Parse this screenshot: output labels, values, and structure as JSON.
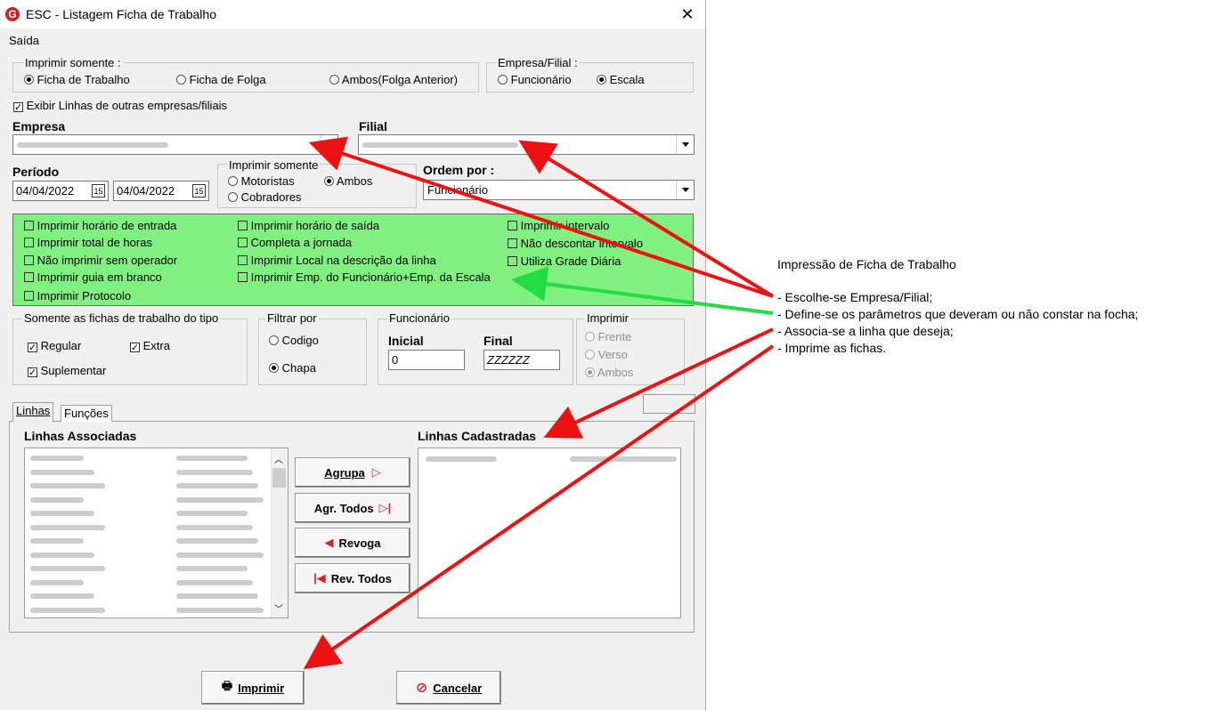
{
  "window": {
    "title": "ESC - Listagem Ficha de Trabalho",
    "menu": "Saída"
  },
  "imprimir_somente": {
    "legend": "Imprimir somente :",
    "options": [
      "Ficha de Trabalho",
      "Ficha de Folga",
      "Ambos(Folga Anterior)"
    ],
    "selected": "Ficha de Trabalho"
  },
  "empresa_filial": {
    "legend": "Empresa/Filial :",
    "options": [
      "Funcionário",
      "Escala"
    ],
    "selected": "Escala"
  },
  "exibir_linhas": {
    "label": "Exibir Linhas de outras empresas/filiais",
    "checked": true
  },
  "empresa": {
    "label": "Empresa"
  },
  "filial": {
    "label": "Filial"
  },
  "periodo": {
    "label": "Período",
    "start": "04/04/2022",
    "end": "04/04/2022",
    "cal_icon_text": "15"
  },
  "imprimir_somente2": {
    "legend": "Imprimir somente",
    "options": [
      "Motoristas",
      "Ambos",
      "Cobradores"
    ],
    "selected": "Ambos"
  },
  "ordem": {
    "label": "Ordem por :",
    "value": "Funcionário"
  },
  "options_panel": {
    "col1": [
      "Imprimir horário de entrada",
      "Imprimir total de horas",
      "Não imprimir sem operador",
      "Imprimir guia em branco",
      "Imprimir Protocolo"
    ],
    "col2": [
      "Imprimir horário de saída",
      "Completa a jornada",
      "Imprimir Local na descrição da linha",
      "Imprimir Emp. do Funcionário+Emp. da Escala"
    ],
    "col3": [
      "Imprimir intervalo",
      "Não descontar intervalo",
      "Utiliza Grade Diária"
    ]
  },
  "somente_fichas": {
    "legend": "Somente as fichas de trabalho do tipo",
    "regular": "Regular",
    "extra": "Extra",
    "suplementar": "Suplementar"
  },
  "filtrar": {
    "legend": "Filtrar por",
    "options": [
      "Codigo",
      "Chapa"
    ],
    "selected": "Chapa"
  },
  "funcionario": {
    "legend": "Funcionário",
    "inicial_label": "Inicial",
    "final_label": "Final",
    "inicial": "0",
    "final": "ZZZZZZ"
  },
  "imprimir": {
    "legend": "Imprimir",
    "options": [
      "Frente",
      "Verso",
      "Ambos"
    ],
    "selected": "Ambos"
  },
  "tabs": [
    "Linhas",
    "Funções"
  ],
  "linhas_associadas": {
    "label": "Linhas Associadas"
  },
  "linhas_cadastradas": {
    "label": "Linhas Cadastradas"
  },
  "buttons": {
    "agrupa": "Agrupa",
    "agr_todos": "Agr. Todos",
    "revoga": "Revoga",
    "rev_todos": "Rev. Todos",
    "imprimir": "Imprimir",
    "cancelar": "Cancelar"
  },
  "annotation": {
    "title": "Impressão de Ficha de Trabalho",
    "lines": [
      "- Escolhe-se Empresa/Filial;",
      "- Define-se os parâmetros que deveram ou não constar na focha;",
      "- Associa-se a linha que deseja;",
      "- Imprime as fichas."
    ]
  },
  "colors": {
    "panel_green": "#80f080",
    "arrow_red": "#ee1111",
    "arrow_green": "#22dd44"
  }
}
